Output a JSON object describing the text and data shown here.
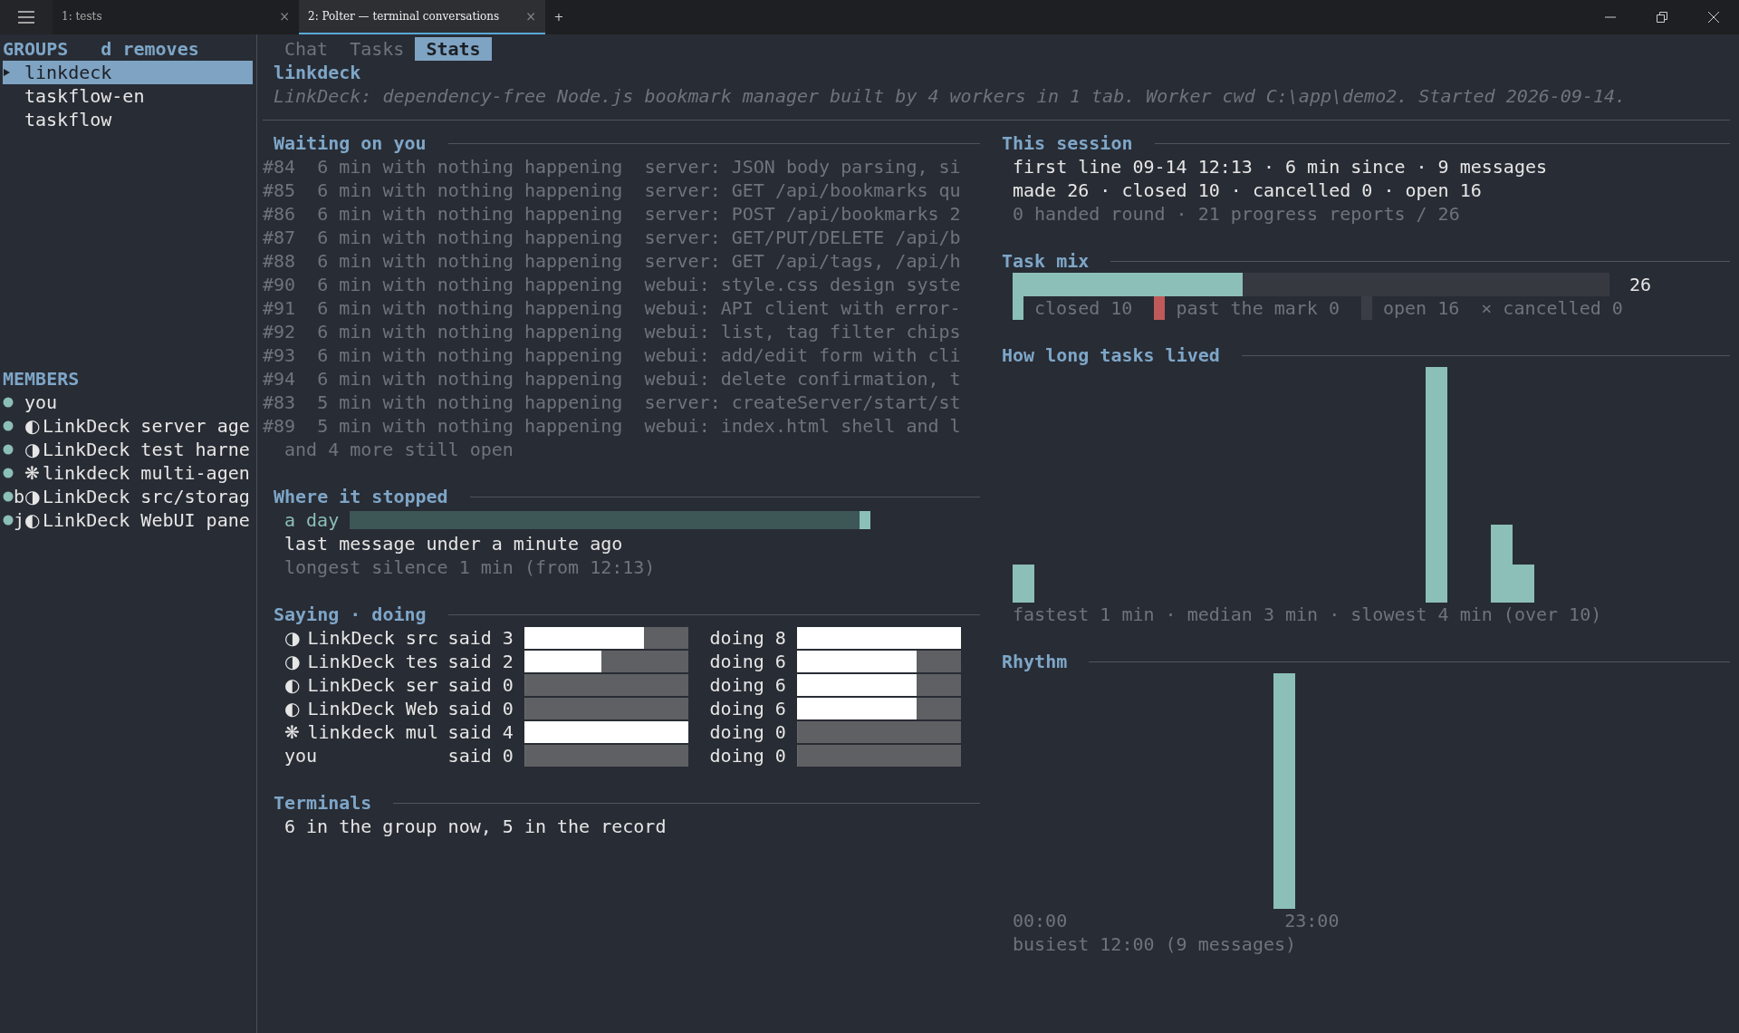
{
  "window_tabs": [
    {
      "label": "1: tests",
      "selected": false
    },
    {
      "label": "2: Polter — terminal conversations",
      "selected": true
    }
  ],
  "new_tab": "+",
  "sidebar": {
    "groups_title": "GROUPS",
    "groups_hint": "d removes",
    "groups": [
      {
        "name": "linkdeck",
        "selected": true
      },
      {
        "name": "taskflow-en",
        "selected": false
      },
      {
        "name": "taskflow",
        "selected": false
      }
    ],
    "members_title": "MEMBERS",
    "members": [
      {
        "name": "you"
      },
      {
        "icon": "◐",
        "name": "LinkDeck server age"
      },
      {
        "icon": "◑",
        "name": "LinkDeck test harne"
      },
      {
        "icon": "❋",
        "name": "linkdeck multi-agen"
      },
      {
        "tag": "b",
        "icon": "◑",
        "name": "LinkDeck src/storag"
      },
      {
        "tag": "j",
        "icon": "◐",
        "name": "LinkDeck WebUI pane"
      }
    ]
  },
  "view_tabs": [
    {
      "label": "Chat",
      "selected": false
    },
    {
      "label": "Tasks",
      "selected": false
    },
    {
      "label": "Stats",
      "selected": true
    }
  ],
  "group": {
    "title": "linkdeck",
    "description": "LinkDeck: dependency-free Node.js bookmark manager built by 4 workers in 1 tab. Worker cwd C:\\app\\demo2. Started 2026-09-14."
  },
  "waiting": {
    "title": "Waiting on you",
    "rows": [
      {
        "id": "#84",
        "idle": "6 min with nothing happening",
        "task": "server: JSON body parsing, si"
      },
      {
        "id": "#85",
        "idle": "6 min with nothing happening",
        "task": "server: GET /api/bookmarks qu"
      },
      {
        "id": "#86",
        "idle": "6 min with nothing happening",
        "task": "server: POST /api/bookmarks 2"
      },
      {
        "id": "#87",
        "idle": "6 min with nothing happening",
        "task": "server: GET/PUT/DELETE /api/b"
      },
      {
        "id": "#88",
        "idle": "6 min with nothing happening",
        "task": "server: GET /api/tags, /api/h"
      },
      {
        "id": "#90",
        "idle": "6 min with nothing happening",
        "task": "webui: style.css design syste"
      },
      {
        "id": "#91",
        "idle": "6 min with nothing happening",
        "task": "webui: API client with error-"
      },
      {
        "id": "#92",
        "idle": "6 min with nothing happening",
        "task": "webui: list, tag filter chips"
      },
      {
        "id": "#93",
        "idle": "6 min with nothing happening",
        "task": "webui: add/edit form with cli"
      },
      {
        "id": "#94",
        "idle": "6 min with nothing happening",
        "task": "webui: delete confirmation, t"
      },
      {
        "id": "#83",
        "idle": "5 min with nothing happening",
        "task": "server: createServer/start/st"
      },
      {
        "id": "#89",
        "idle": "5 min with nothing happening",
        "task": "webui: index.html shell and l"
      }
    ],
    "more": "and 4 more still open"
  },
  "stopped": {
    "title": "Where it stopped",
    "span_label": "a day",
    "level": 1,
    "last": "last message under a minute ago",
    "silence": "longest silence 1 min (from 12:13)"
  },
  "saying": {
    "title": "Saying · doing",
    "rows": [
      {
        "icon": "◑",
        "name": "LinkDeck src",
        "said": {
          "text": "said 3",
          "level": 0.73
        },
        "doing": {
          "text": "doing 8",
          "level": 1
        }
      },
      {
        "icon": "◑",
        "name": "LinkDeck tes",
        "said": {
          "text": "said 2",
          "level": 0.47
        },
        "doing": {
          "text": "doing 6",
          "level": 0.73
        }
      },
      {
        "icon": "◐",
        "name": "LinkDeck ser",
        "said": {
          "text": "said 0",
          "level": 0
        },
        "doing": {
          "text": "doing 6",
          "level": 0.73
        }
      },
      {
        "icon": "◐",
        "name": "LinkDeck Web",
        "said": {
          "text": "said 0",
          "level": 0
        },
        "doing": {
          "text": "doing 6",
          "level": 0.73
        }
      },
      {
        "icon": "❋",
        "name": "linkdeck mul",
        "said": {
          "text": "said 4",
          "level": 1
        },
        "doing": {
          "text": "doing 0",
          "level": 0
        }
      },
      {
        "name": "you",
        "said": {
          "text": "said 0",
          "level": 0
        },
        "doing": {
          "text": "doing 0",
          "level": 0
        }
      }
    ]
  },
  "terminals": {
    "title": "Terminals",
    "text": "6 in the group now, 5 in the record"
  },
  "session": {
    "title": "This session",
    "lines": [
      "first line 09-14 12:13 · 6 min since · 9 messages",
      "made 26 · closed 10 · cancelled 0 · open 16"
    ],
    "note": "0 handed round · 21 progress reports / 26"
  },
  "task_mix": {
    "title": "Task mix",
    "level": 0.385,
    "total": "26",
    "legend": [
      {
        "kind": "swatch",
        "color": "#8bbfb7",
        "label": "closed 10"
      },
      {
        "kind": "swatch",
        "color": "#c05a5a",
        "label": "past the mark 0"
      },
      {
        "kind": "swatch",
        "color": "#3a3e44",
        "label": "open 16"
      },
      {
        "kind": "cross",
        "marker": "×",
        "label": "cancelled 0"
      }
    ]
  },
  "lifetimes": {
    "title": "How long tasks lived",
    "summary": "fastest 1 min · median 3 min · slowest 4 min (over 10)"
  },
  "rhythm": {
    "title": "Rhythm",
    "start": "00:00",
    "end": "23:00",
    "summary": "busiest 12:00 (9 messages)"
  }
}
